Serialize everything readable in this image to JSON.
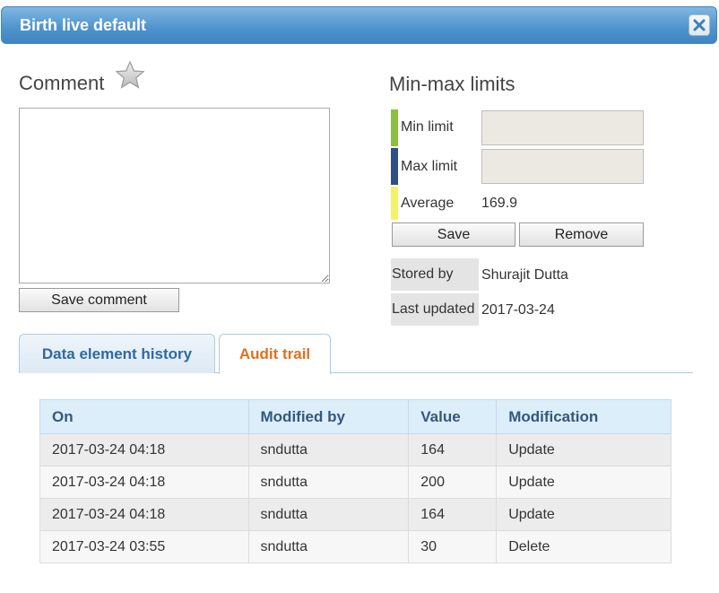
{
  "dialog": {
    "title": "Birth live default"
  },
  "comment": {
    "heading": "Comment",
    "value": "",
    "save_label": "Save comment"
  },
  "minmax": {
    "heading": "Min-max limits",
    "min_label": "Min limit",
    "min_value": "",
    "max_label": "Max limit",
    "max_value": "",
    "avg_label": "Average",
    "avg_value": "169.9",
    "save_label": "Save",
    "remove_label": "Remove",
    "colors": {
      "min": "#8cbf3f",
      "max": "#2f4f86",
      "avg": "#f3f36b"
    }
  },
  "meta": {
    "stored_by_label": "Stored by",
    "stored_by_value": "Shurajit Dutta",
    "last_updated_label": "Last updated",
    "last_updated_value": "2017-03-24"
  },
  "tabs": [
    {
      "label": "Data element history",
      "active": false
    },
    {
      "label": "Audit trail",
      "active": true
    }
  ],
  "audit": {
    "columns": [
      "On",
      "Modified by",
      "Value",
      "Modification"
    ],
    "rows": [
      [
        "2017-03-24 04:18",
        "sndutta",
        "164",
        "Update"
      ],
      [
        "2017-03-24 04:18",
        "sndutta",
        "200",
        "Update"
      ],
      [
        "2017-03-24 04:18",
        "sndutta",
        "164",
        "Update"
      ],
      [
        "2017-03-24 03:55",
        "sndutta",
        "30",
        "Delete"
      ]
    ]
  },
  "icons": {
    "close": "close-icon",
    "star": "star-icon"
  }
}
